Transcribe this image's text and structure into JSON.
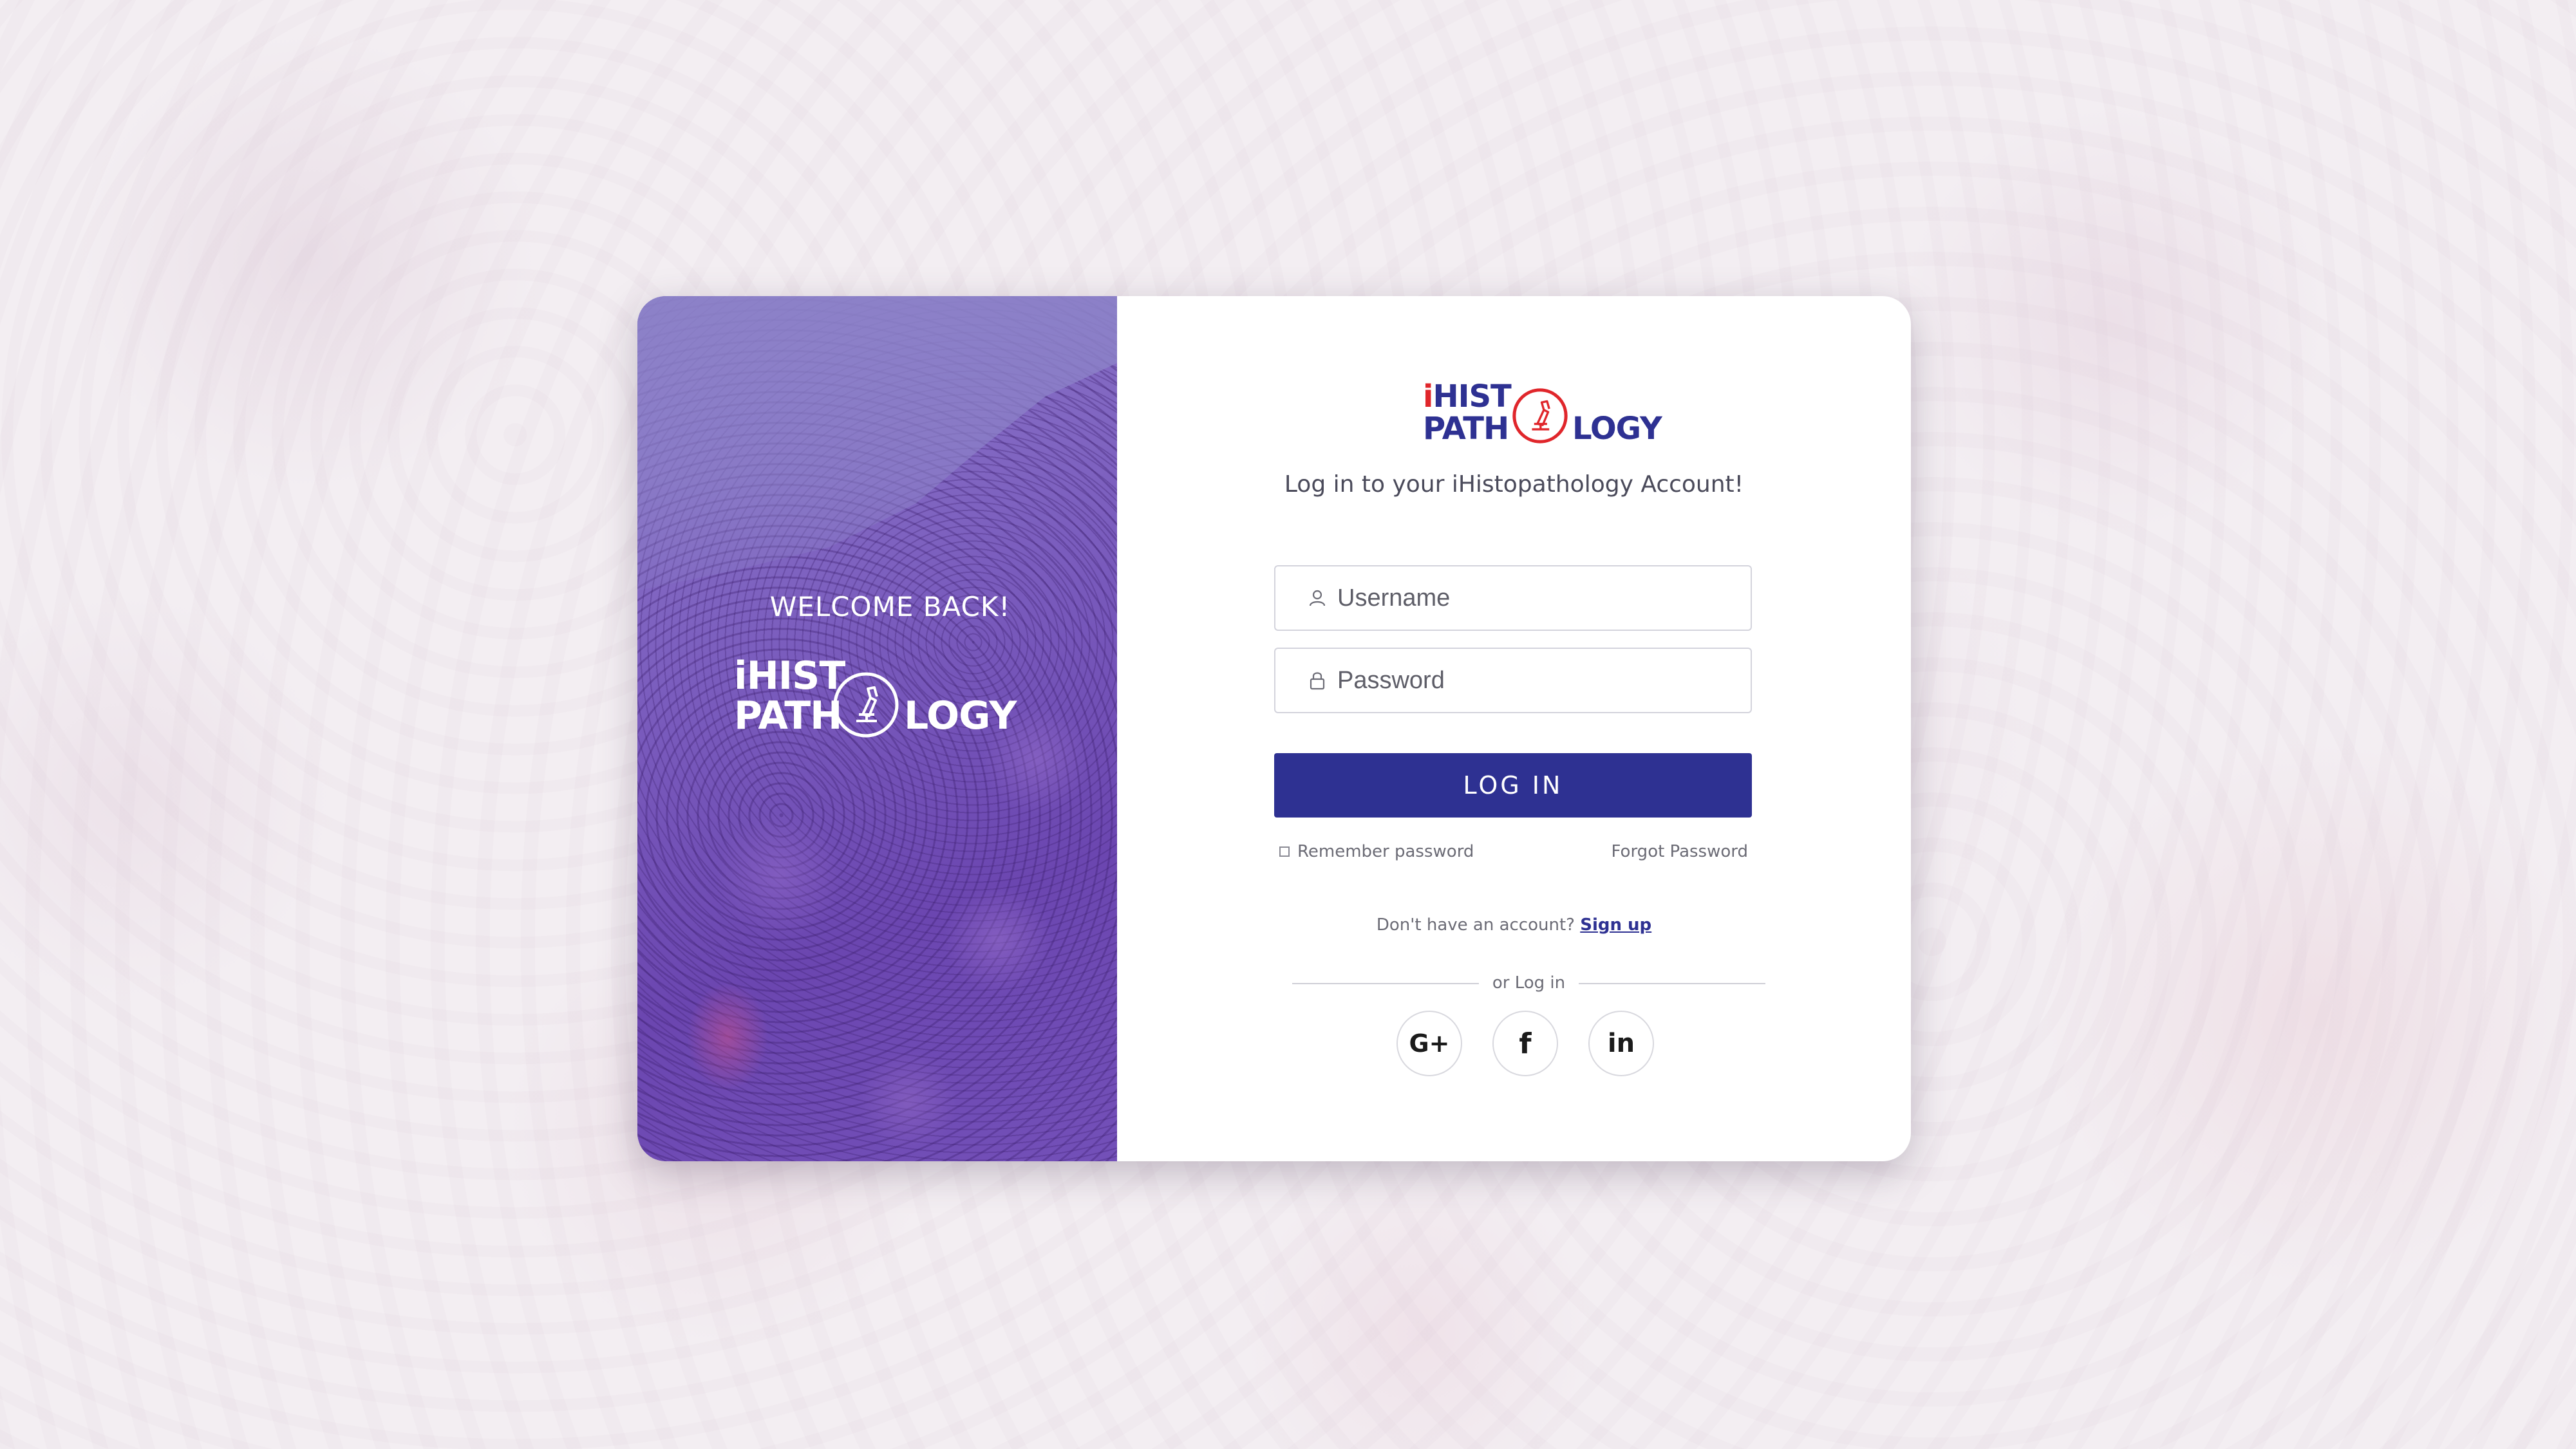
{
  "brand": {
    "logo_line1": "iHIST",
    "logo_line2_left": "PATH",
    "logo_line2_right": "LOGY",
    "primary_color": "#2e3192",
    "accent_color": "#e0262b"
  },
  "left_panel": {
    "welcome": "WELCOME BACK!"
  },
  "login": {
    "subtitle": "Log in to your iHistopathology Account!",
    "username_placeholder": "Username",
    "password_placeholder": "Password",
    "login_button": "LOG IN",
    "remember_label": "Remember password",
    "forgot_label": "Forgot Password",
    "no_account_text": "Don't  have an account?",
    "signup_label": "Sign up",
    "divider_text": "or Log in"
  },
  "social": [
    {
      "label": "G+",
      "icon": "google-plus-icon"
    },
    {
      "label": "f",
      "icon": "facebook-icon"
    },
    {
      "label": "in",
      "icon": "linkedin-icon"
    }
  ],
  "icons": {
    "username": "user-icon",
    "password": "lock-icon"
  }
}
